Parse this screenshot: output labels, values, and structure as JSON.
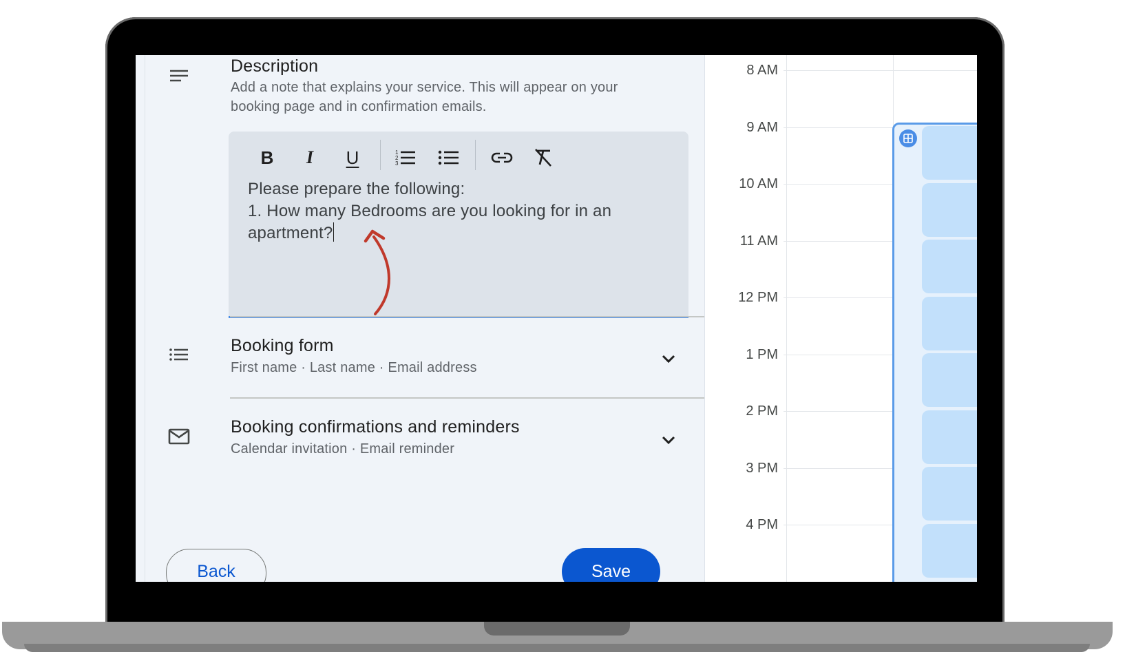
{
  "description": {
    "title": "Description",
    "subtitle_line1": "Add a note that explains your service. This will appear on your",
    "subtitle_line2": "booking page and in confirmation emails.",
    "editor_line1": "Please prepare the following:",
    "editor_line2": "1. How many Bedrooms are you looking for in an",
    "editor_line3": "apartment?",
    "toolbar": [
      "bold-icon",
      "italic-icon",
      "underline-icon",
      "numbered-list-icon",
      "bulleted-list-icon",
      "link-icon",
      "clear-formatting-icon"
    ]
  },
  "booking_form": {
    "title": "Booking form",
    "subtitle": "First name · Last name · Email address"
  },
  "confirmations": {
    "title": "Booking confirmations and reminders",
    "subtitle": "Calendar invitation · Email reminder"
  },
  "buttons": {
    "back": "Back",
    "save": "Save"
  },
  "calendar": {
    "hours": [
      "8 AM",
      "9 AM",
      "10 AM",
      "11 AM",
      "12 PM",
      "1 PM",
      "2 PM",
      "3 PM",
      "4 PM"
    ]
  },
  "colors": {
    "accent": "#0b57d0",
    "editor_underline": "#4a8de6",
    "annotation_arrow": "#c0392b",
    "event_fill": "#c2e0fb"
  }
}
